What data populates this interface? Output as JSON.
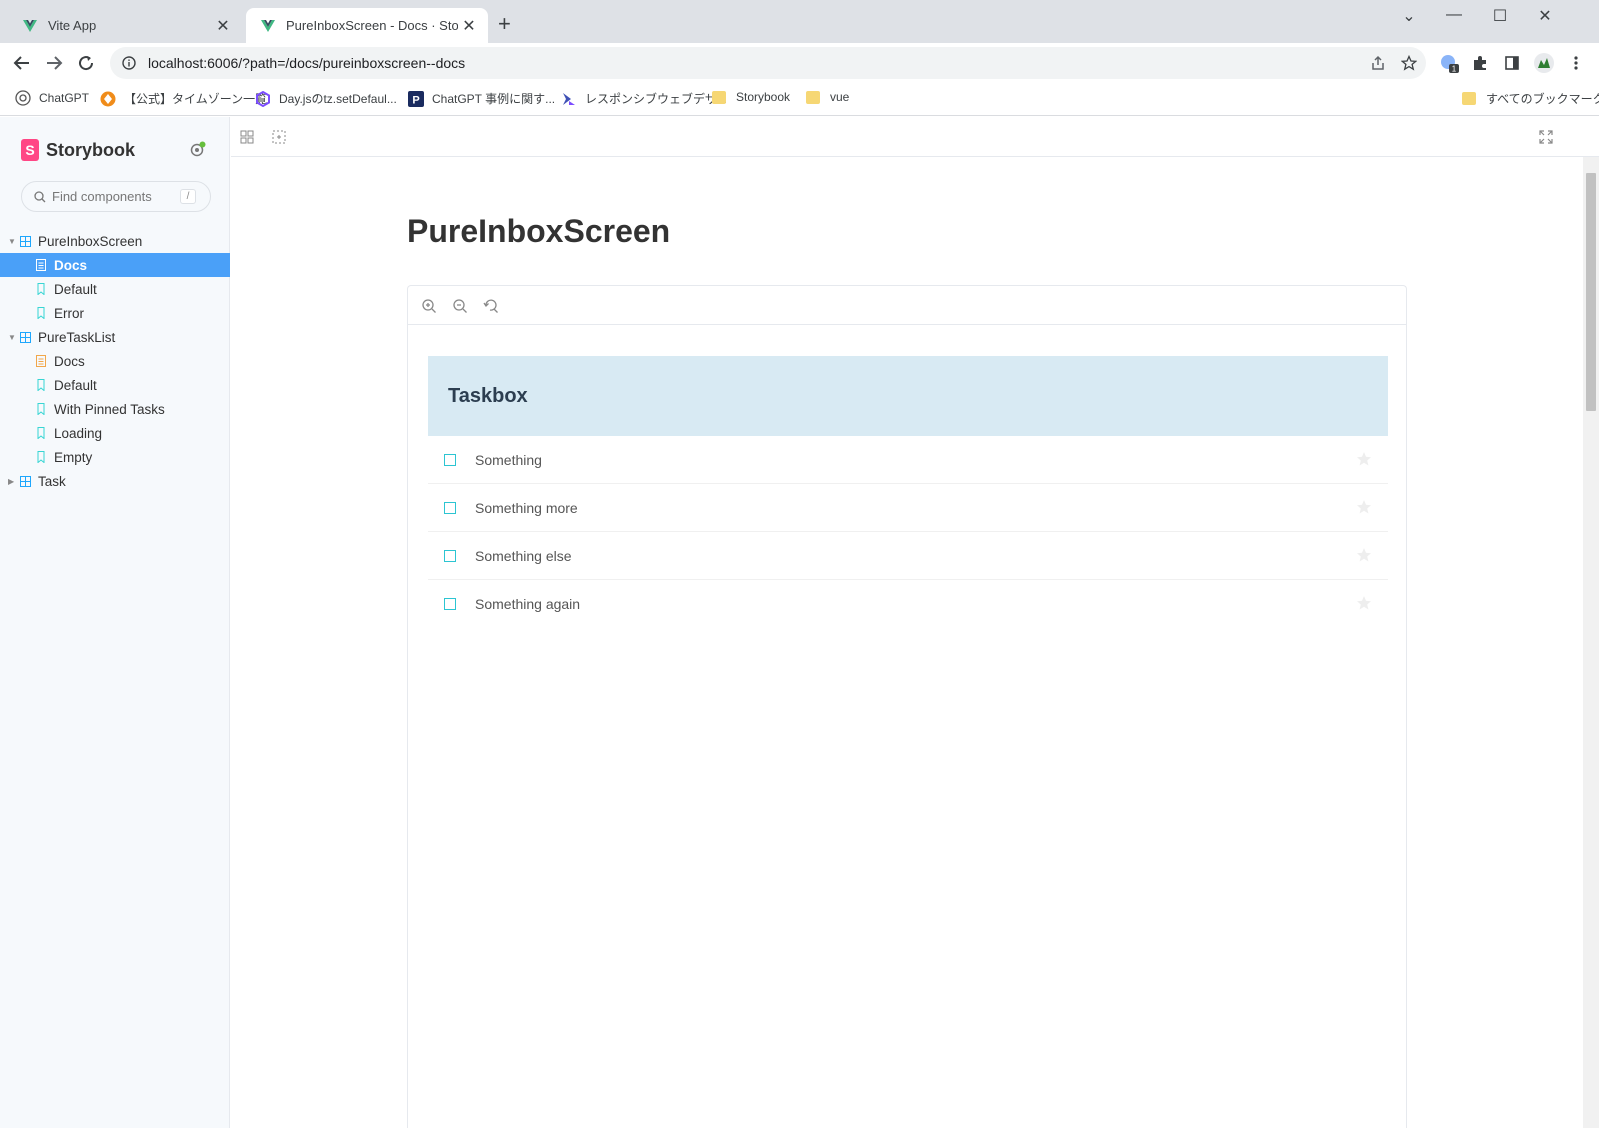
{
  "browser": {
    "tabs": [
      {
        "title": "Vite App",
        "active": false
      },
      {
        "title": "PureInboxScreen - Docs · Storyb",
        "active": true
      }
    ],
    "url": "localhost:6006/?path=/docs/pureinboxscreen--docs",
    "bookmarks": [
      {
        "label": "ChatGPT",
        "icon": "chatgpt-icon"
      },
      {
        "label": "【公式】タイムゾーン一覧",
        "icon": "orange-diamond-icon"
      },
      {
        "label": "Day.jsのtz.setDefaul...",
        "icon": "hexagon-icon"
      },
      {
        "label": "ChatGPT 事例に関す...",
        "icon": "p-logo-icon"
      },
      {
        "label": "レスポンシブウェブデザ...",
        "icon": "arrow-logo-icon"
      },
      {
        "label": "Storybook",
        "icon": "folder-icon"
      },
      {
        "label": "vue",
        "icon": "folder-icon"
      }
    ],
    "all_bookmarks": "すべてのブックマーク",
    "extension_badge": "1"
  },
  "sidebar": {
    "brand": "Storybook",
    "search_placeholder": "Find components",
    "search_shortcut": "/",
    "tree": [
      {
        "label": "PureInboxScreen",
        "type": "group",
        "expanded": true
      },
      {
        "label": "Docs",
        "type": "docs",
        "selected": true
      },
      {
        "label": "Default",
        "type": "story"
      },
      {
        "label": "Error",
        "type": "story"
      },
      {
        "label": "PureTaskList",
        "type": "group",
        "expanded": true
      },
      {
        "label": "Docs",
        "type": "docs"
      },
      {
        "label": "Default",
        "type": "story"
      },
      {
        "label": "With Pinned Tasks",
        "type": "story"
      },
      {
        "label": "Loading",
        "type": "story"
      },
      {
        "label": "Empty",
        "type": "story"
      },
      {
        "label": "Task",
        "type": "group",
        "expanded": false
      }
    ]
  },
  "main": {
    "title": "PureInboxScreen",
    "taskbox": {
      "heading": "Taskbox",
      "tasks": [
        "Something",
        "Something more",
        "Something else",
        "Something again"
      ]
    }
  },
  "colors": {
    "accent": "#4aa0f8",
    "storybook_pink": "#ff4785",
    "taskbox_header": "#d8eaf3",
    "checkbox": "#2cc5d2"
  }
}
